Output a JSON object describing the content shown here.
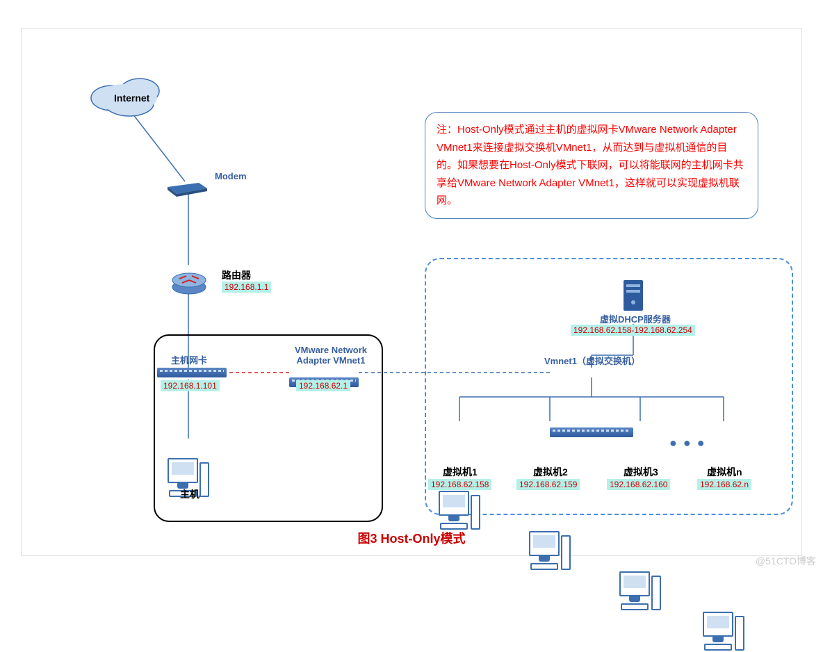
{
  "caption": "图3  Host-Only模式",
  "watermark": "@51CTO博客",
  "note": "注：Host-Only模式通过主机的虚拟网卡VMware Network Adapter VMnet1来连接虚拟交换机VMnet1，从而达到与虚拟机通信的目的。如果想要在Host-Only模式下联网，可以将能联网的主机网卡共享给VMware Network Adapter VMnet1，这样就可以实现虚拟机联网。",
  "internet": {
    "label": "Internet"
  },
  "modem": {
    "label": "Modem"
  },
  "router": {
    "label": "路由器",
    "ip": "192.168.1.1"
  },
  "host": {
    "nic_label": "主机网卡",
    "nic_ip": "192.168.1.101",
    "vmnet_label_l1": "VMware Network",
    "vmnet_label_l2": "Adapter VMnet1",
    "vmnet_ip": "192.168.62.1",
    "label": "主机"
  },
  "virt": {
    "switch_label": "Vmnet1（虚拟交换机）",
    "dhcp_label": "虚拟DHCP服务器",
    "dhcp_range": "192.168.62.158-192.168.62.254"
  },
  "vms": [
    {
      "label": "虚拟机1",
      "ip": "192.168.62.158"
    },
    {
      "label": "虚拟机2",
      "ip": "192.168.62.159"
    },
    {
      "label": "虚拟机3",
      "ip": "192.168.62.160"
    },
    {
      "label": "虚拟机n",
      "ip": "192.168.62.n"
    }
  ],
  "ellipsis": "● ● ●"
}
